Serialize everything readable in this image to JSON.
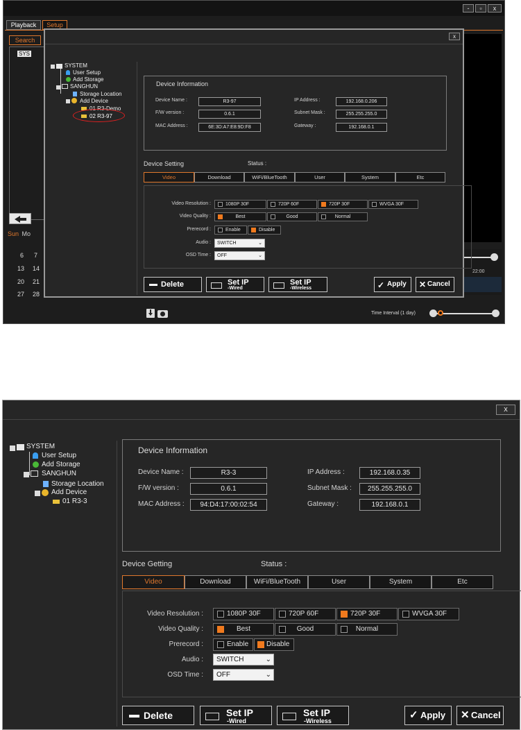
{
  "top": {
    "tabs": [
      "Playback",
      "Setup"
    ],
    "search_label": "Search",
    "tree_stub": "SYS",
    "cal_header": [
      "Sun",
      "Mo"
    ],
    "cal_rows": [
      [
        "6",
        "7"
      ],
      [
        "13",
        "14"
      ],
      [
        "20",
        "21"
      ],
      [
        "27",
        "28"
      ]
    ],
    "time_label": "22:00",
    "interval_label": "Time Interval (1 day)",
    "close": "x",
    "win_buttons": [
      "-",
      "▫",
      "x"
    ],
    "tree": {
      "system": "SYSTEM",
      "user_setup": "User Setup",
      "add_storage": "Add Storage",
      "sanghun": "SANGHUN",
      "storage_location": "Storage Location",
      "add_device": "Add Device",
      "device1": "01 R3-Demo",
      "device2": "02 R3-97"
    },
    "info": {
      "title": "Device Information",
      "device_name_label": "Device Name :",
      "device_name": "R3-97",
      "fw_label": "F/W version :",
      "fw": "0.6.1",
      "mac_label": "MAC Address :",
      "mac": "6E:3D:A7:E8:9D:F8",
      "ip_label": "IP Address :",
      "ip": "192.168.0.206",
      "subnet_label": "Subnet Mask :",
      "subnet": "255.255.255.0",
      "gateway_label": "Gateway :",
      "gateway": "192.168.0.1"
    },
    "setting_title": "Device Setting",
    "status_label": "Status :",
    "tabs2": [
      "Video",
      "Download",
      "WiFi/BlueTooth",
      "User",
      "System",
      "Etc"
    ],
    "video": {
      "res_label": "Video Resolution :",
      "res_options": [
        "1080P 30F",
        "720P 60F",
        "720P 30F",
        "WVGA 30F"
      ],
      "quality_label": "Video Quality :",
      "quality_options": [
        "Best",
        "Good",
        "Normal"
      ],
      "prerecord_label": "Prerecord :",
      "prerecord_options": [
        "Enable",
        "Disable"
      ],
      "audio_label": "Audio :",
      "audio_value": "SWITCH",
      "osd_label": "OSD Time :",
      "osd_value": "OFF"
    },
    "buttons": {
      "delete": "Delete",
      "set_ip": "Set IP",
      "wired": "-Wired",
      "wireless": "-Wireless",
      "apply": "Apply",
      "cancel": "Cancel"
    }
  },
  "bottom": {
    "close": "x",
    "tree": {
      "system": "SYSTEM",
      "user_setup": "User Setup",
      "add_storage": "Add Storage",
      "sanghun": "SANGHUN",
      "storage_location": "Storage Location",
      "add_device": "Add Device",
      "device1": "01 R3-3"
    },
    "info": {
      "title": "Device Information",
      "device_name_label": "Device Name :",
      "device_name": "R3-3",
      "fw_label": "F/W version :",
      "fw": "0.6.1",
      "mac_label": "MAC Address :",
      "mac": "94:D4:17:00:02:54",
      "ip_label": "IP Address :",
      "ip": "192.168.0.35",
      "subnet_label": "Subnet Mask :",
      "subnet": "255.255.255.0",
      "gateway_label": "Gateway :",
      "gateway": "192.168.0.1"
    },
    "setting_title": "Device Getting",
    "status_label": "Status :",
    "tabs2": [
      "Video",
      "Download",
      "WiFi/BlueTooth",
      "User",
      "System",
      "Etc"
    ],
    "video": {
      "res_label": "Video Resolution :",
      "res_options": [
        "1080P 30F",
        "720P 60F",
        "720P 30F",
        "WVGA 30F"
      ],
      "quality_label": "Video Quality :",
      "quality_options": [
        "Best",
        "Good",
        "Normal"
      ],
      "prerecord_label": "Prerecord :",
      "prerecord_options": [
        "Enable",
        "Disable"
      ],
      "audio_label": "Audio :",
      "audio_value": "SWITCH",
      "osd_label": "OSD Time :",
      "osd_value": "OFF"
    },
    "buttons": {
      "delete": "Delete",
      "set_ip": "Set IP",
      "wired": "-Wired",
      "wireless": "-Wireless",
      "apply": "Apply",
      "cancel": "Cancel"
    }
  },
  "colors": {
    "accent": "#f07a1e",
    "background": "#1e1e1e",
    "highlight_circle": "#e02020"
  }
}
